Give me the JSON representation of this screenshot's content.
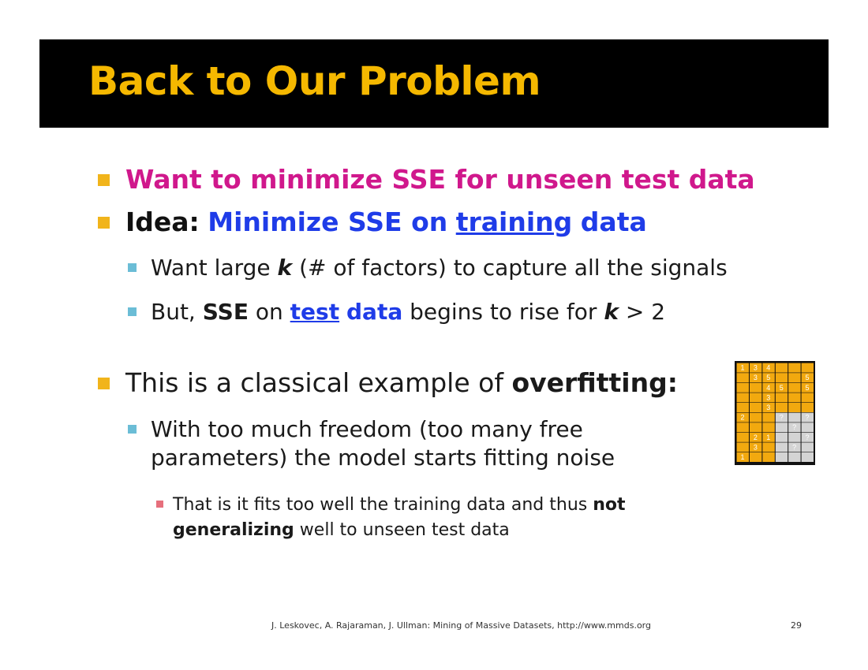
{
  "title": "Back to Our Problem",
  "bullets": {
    "b1": "Want to minimize SSE for unseen test data",
    "b2_lead": "Idea:",
    "b2_blue1": "Minimize SSE on",
    "b2_link": "training",
    "b2_blue2": "data",
    "s1_a": "Want large",
    "s1_k": "k",
    "s1_b": "(# of factors) to capture all the signals",
    "s2_a": "But,",
    "s2_sse": "SSE",
    "s2_on": "on",
    "s2_link": "test",
    "s2_data": "data",
    "s2_b": "begins to rise for",
    "s2_k": "k",
    "s2_c": "> 2",
    "b3_a": "This is a classical example of",
    "b3_b": "overfitting:",
    "s3_line1": "With too much freedom (too many free",
    "s3_line2": "parameters) the model starts fitting noise",
    "t1_a": "That is it fits too well the training data and thus",
    "t1_not": "not",
    "t1_gen": "generalizing",
    "t1_b": "well to unseen test data"
  },
  "matrix": {
    "rows": [
      [
        "1",
        "3",
        "4",
        "",
        "",
        ""
      ],
      [
        "",
        "3",
        "5",
        "",
        "",
        "5"
      ],
      [
        "",
        "",
        "4",
        "5",
        "",
        "5"
      ],
      [
        "",
        "",
        "3",
        "",
        "",
        ""
      ],
      [
        "",
        "",
        "3",
        "",
        "",
        ""
      ],
      [
        "2",
        "",
        "",
        "?",
        "",
        "?"
      ],
      [
        "",
        "",
        "",
        "",
        "?",
        ""
      ],
      [
        "",
        "2",
        "1",
        "",
        "",
        "?"
      ],
      [
        "",
        "3",
        "",
        "",
        "?",
        ""
      ],
      [
        "1",
        "",
        "",
        "",
        "",
        ""
      ]
    ],
    "orange": "#f2a90f",
    "gray": "#d4d4d4"
  },
  "footer": "J. Leskovec, A. Rajaraman, J. Ullman: Mining of Massive Datasets, http://www.mmds.org",
  "page_number": "29"
}
